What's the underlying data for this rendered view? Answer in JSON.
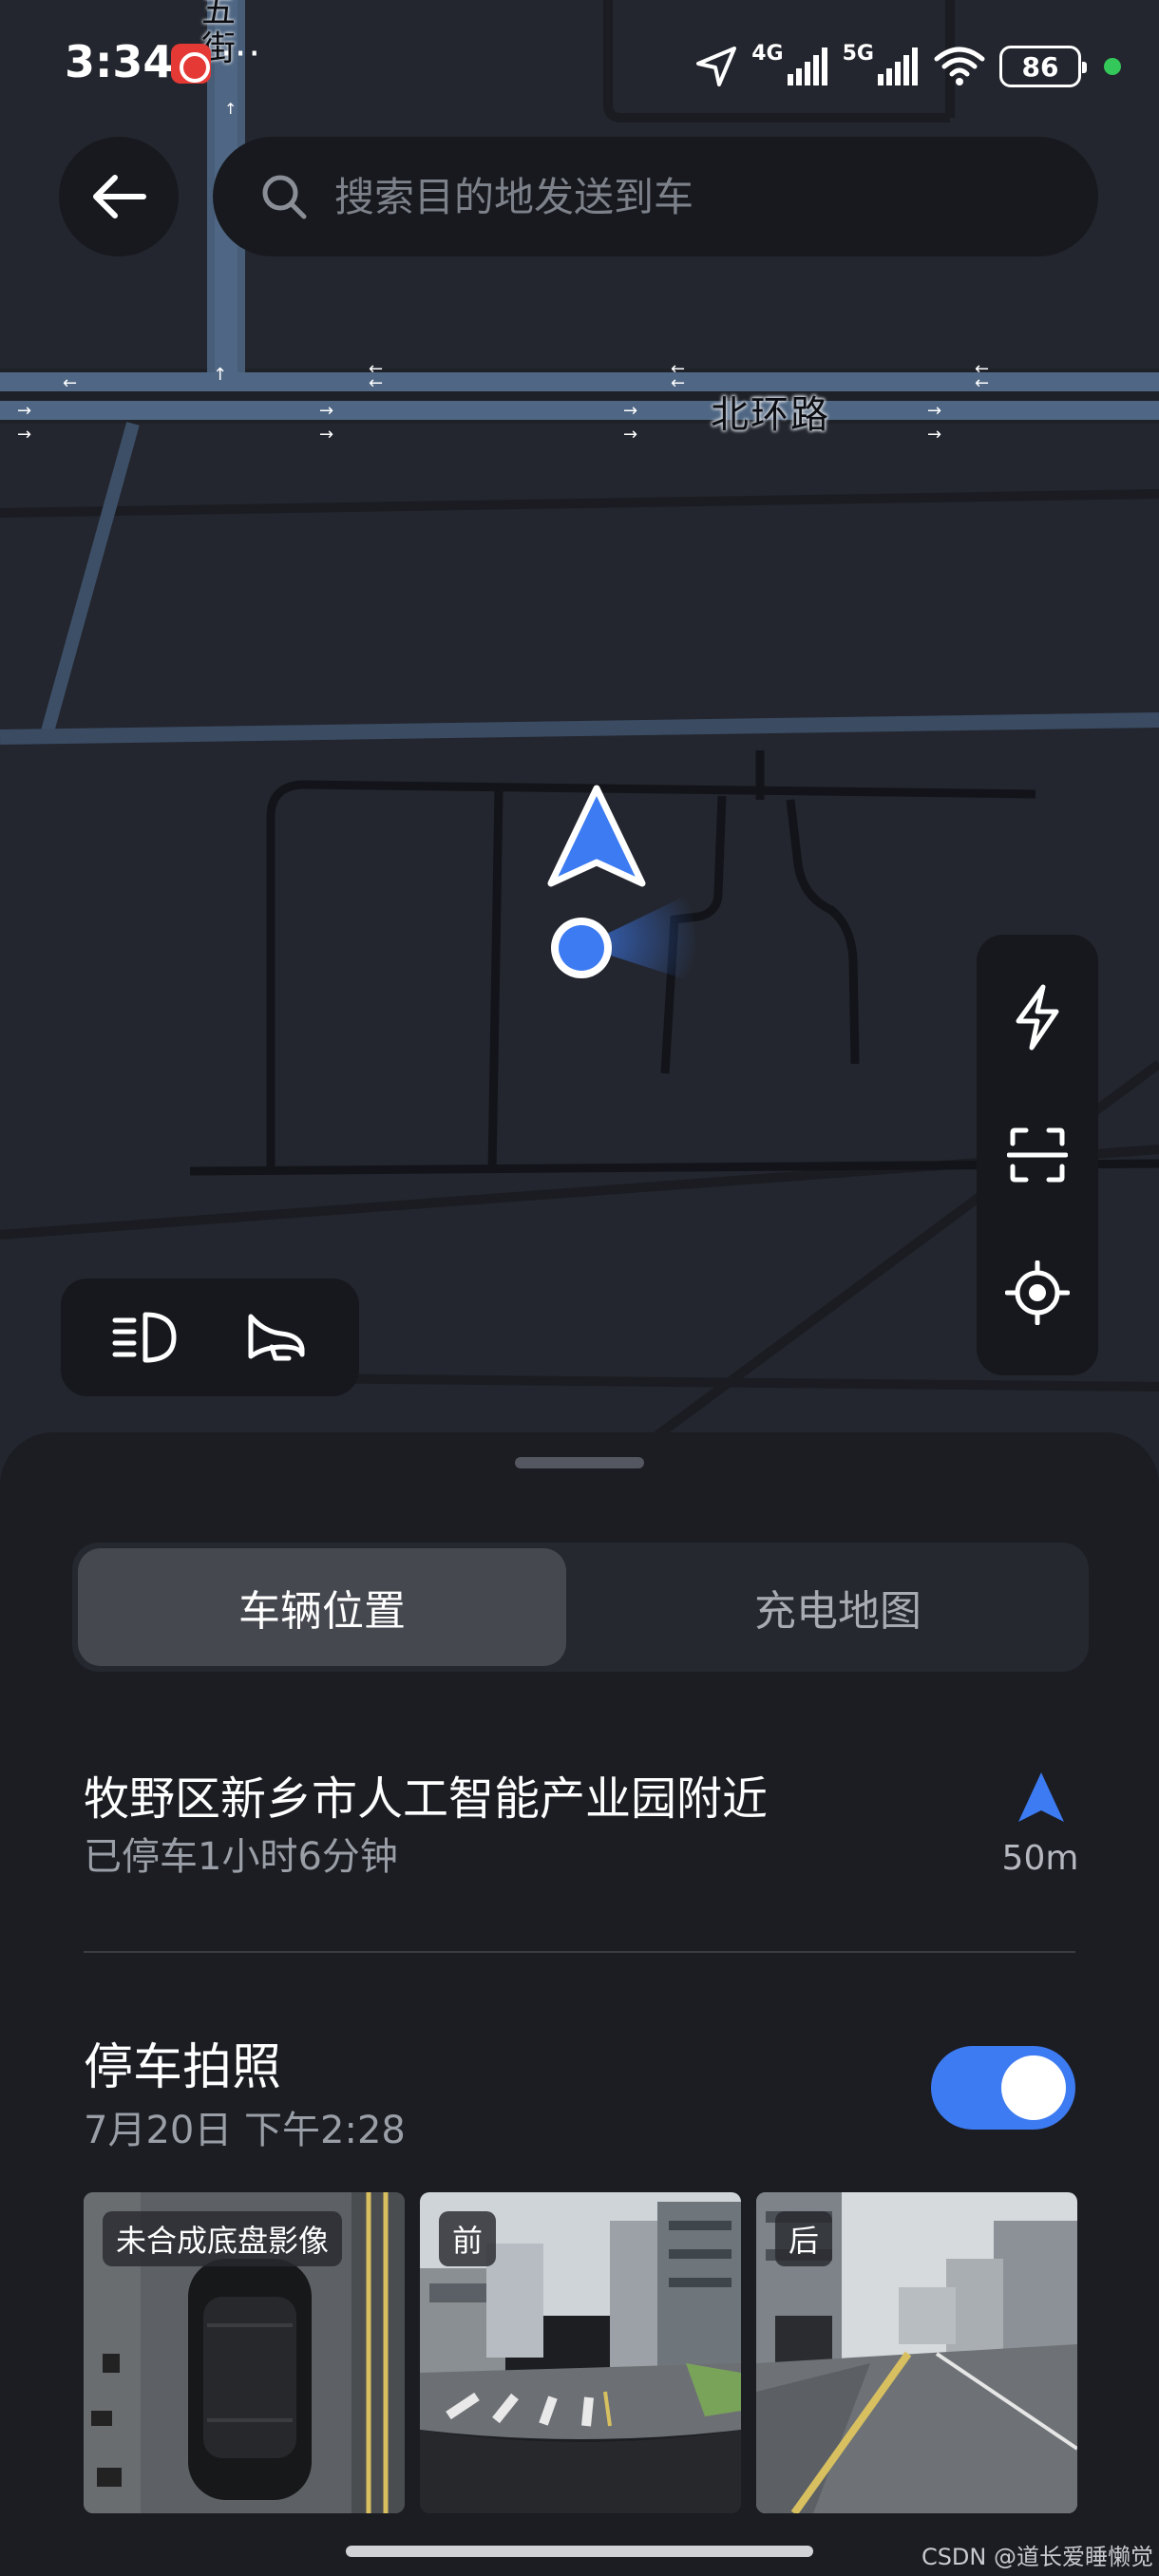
{
  "status_bar": {
    "time": "3:34",
    "more": "···",
    "network_a": "4G",
    "network_b": "5G",
    "battery": "86"
  },
  "map": {
    "road_name": "北环路",
    "street_name": "五\n街"
  },
  "search": {
    "placeholder": "搜索目的地发送到车"
  },
  "icons": {
    "back": "back-arrow-icon",
    "search": "search-icon",
    "charge": "lightning-icon",
    "scan": "scan-icon",
    "locate": "locate-icon",
    "headlight": "headlight-icon",
    "horn": "horn-icon",
    "vehicle": "navigation-arrow-icon",
    "user_location": "location-dot-icon"
  },
  "tabs": {
    "vehicle_location": "车辆位置",
    "charging_map": "充电地图"
  },
  "location": {
    "title": "牧野区新乡市人工智能产业园附近",
    "subtitle": "已停车1小时6分钟",
    "distance": "50m"
  },
  "parking_photos": {
    "title": "停车拍照",
    "date": "7月20日 下午2:28",
    "toggle_on": true,
    "thumbnails": [
      {
        "tag": "未合成底盘影像"
      },
      {
        "tag": "前"
      },
      {
        "tag": "后"
      }
    ]
  },
  "watermark": "CSDN @道长爱睡懒觉",
  "colors": {
    "accent": "#3d7bf2",
    "map_bg": "#23262e",
    "sheet_bg": "#1b1d23"
  }
}
